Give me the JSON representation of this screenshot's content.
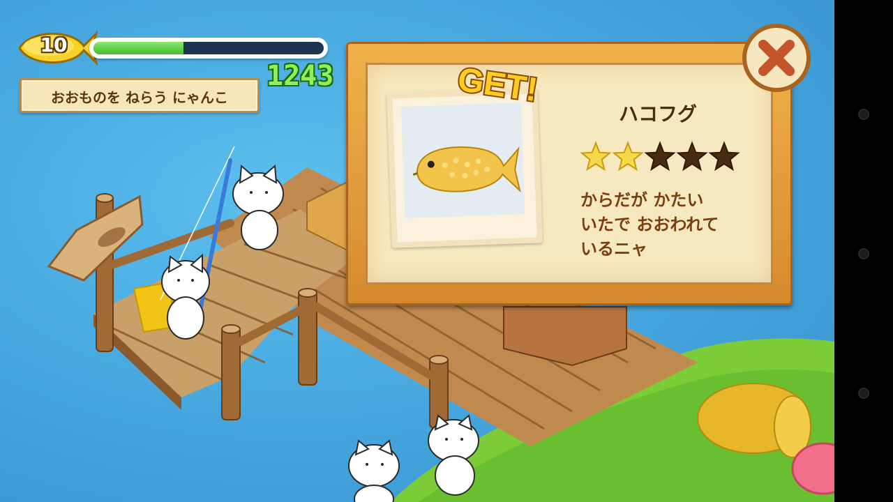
{
  "hud": {
    "level": "10",
    "xp_progress": 0.39,
    "score": "1243",
    "title": "おおものを ねらう にゃんこ"
  },
  "catch_modal": {
    "banner": "GET!",
    "fish_name": "ハコフグ",
    "rarity": {
      "filled": 2,
      "total": 5
    },
    "description": [
      "からだが かたい",
      "いたで おおわれて",
      "いるニャ"
    ],
    "close_icon": "close-x-icon"
  },
  "colors": {
    "water": "#44a4dc",
    "frame": "#d68a2e",
    "xp_fill": "#3fbe2c",
    "score": "#8ff05a",
    "star_filled": "#f6d84a",
    "star_empty": "#4a2c10"
  }
}
